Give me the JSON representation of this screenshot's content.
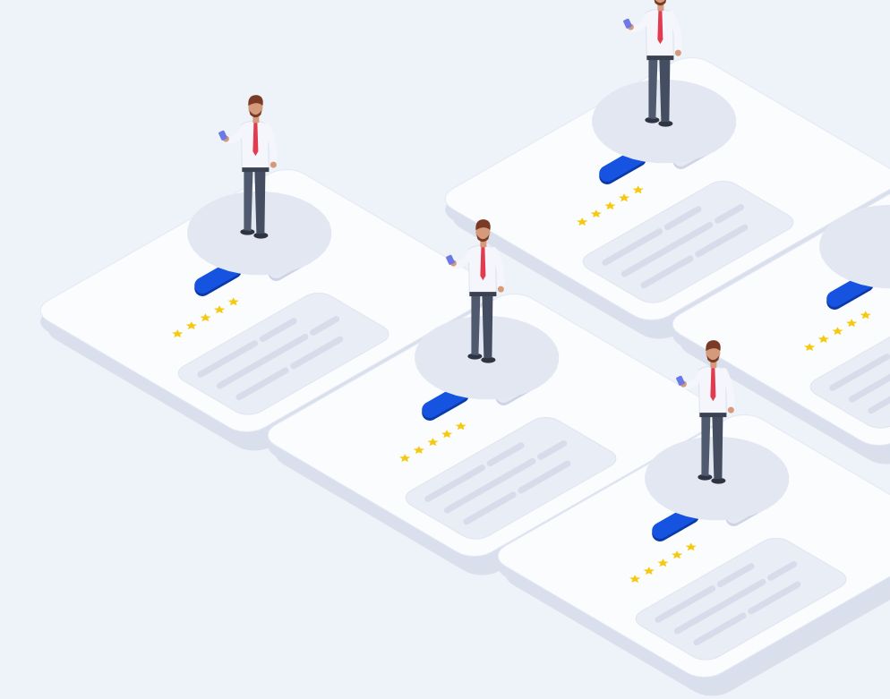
{
  "colors": {
    "background": "#eef2f9",
    "card_top": "#fbfcfe",
    "card_side": "#d9dfec",
    "card_shadow": "#c8d0e0",
    "inner_panel": "#e9edf6",
    "text_line": "#d6dcea",
    "platform": "#e2e7f2",
    "primary_button": "#1553e0",
    "secondary_button": "#e5e9f3",
    "star": "#f5c90f",
    "shirt": "#f4f6fb",
    "tie": "#e23a4f",
    "trousers": "#505a6e",
    "hair": "#7a3a26",
    "skin": "#d59a7b",
    "shoes": "#2f3442"
  },
  "cards": [
    {
      "id": "review-card-1",
      "rating": 5,
      "button_style": "primary",
      "has_person": true,
      "person_icon": "man-holding-phone-icon"
    },
    {
      "id": "review-card-2",
      "rating": 5,
      "button_style": "primary",
      "has_person": true,
      "person_icon": "man-holding-phone-icon"
    },
    {
      "id": "review-card-3",
      "rating": 5,
      "button_style": "primary",
      "has_person": true,
      "person_icon": "man-holding-phone-icon"
    },
    {
      "id": "review-card-4",
      "rating": 5,
      "button_style": "primary",
      "has_person": false
    },
    {
      "id": "review-card-5",
      "rating": 5,
      "button_style": "primary",
      "has_person": true,
      "person_icon": "man-holding-phone-icon"
    }
  ]
}
